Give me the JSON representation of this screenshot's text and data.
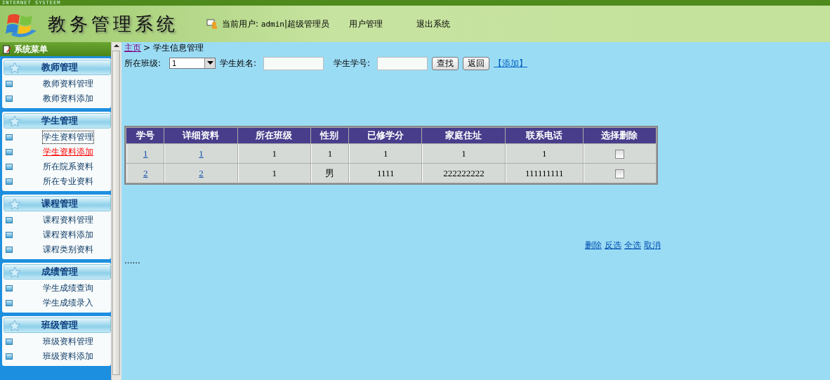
{
  "top_strip": {
    "text": "INTERNET SYSTEEM"
  },
  "header": {
    "title": "教务管理系统",
    "current_user_label": "当前用户:",
    "user": "admin",
    "separator": "|",
    "role": "超级管理员",
    "links": [
      "用户管理",
      "退出系统"
    ]
  },
  "sidebar": {
    "title": "系统菜单",
    "groups": [
      {
        "title": "教师管理",
        "items": [
          {
            "label": "教师资料管理",
            "selected": false,
            "focused": false
          },
          {
            "label": "教师资料添加",
            "selected": false,
            "focused": false
          }
        ]
      },
      {
        "title": "学生管理",
        "items": [
          {
            "label": "学生资料管理",
            "selected": false,
            "focused": true
          },
          {
            "label": "学生资料添加",
            "selected": true,
            "focused": false
          },
          {
            "label": "所在院系资料",
            "selected": false,
            "focused": false
          },
          {
            "label": "所在专业资料",
            "selected": false,
            "focused": false
          }
        ]
      },
      {
        "title": "课程管理",
        "items": [
          {
            "label": "课程资料管理",
            "selected": false,
            "focused": false
          },
          {
            "label": "课程资料添加",
            "selected": false,
            "focused": false
          },
          {
            "label": "课程类别资料",
            "selected": false,
            "focused": false
          }
        ]
      },
      {
        "title": "成绩管理",
        "items": [
          {
            "label": "学生成绩查询",
            "selected": false,
            "focused": false
          },
          {
            "label": "学生成绩录入",
            "selected": false,
            "focused": false
          }
        ]
      },
      {
        "title": "班级管理",
        "items": [
          {
            "label": "班级资料管理",
            "selected": false,
            "focused": false
          },
          {
            "label": "班级资料添加",
            "selected": false,
            "focused": false
          }
        ]
      }
    ]
  },
  "breadcrumb": {
    "home": "主页",
    "separator": ">",
    "current": "学生信息管理"
  },
  "filters": {
    "class_label": "所在班级:",
    "class_value": "1",
    "name_label": "学生姓名:",
    "number_label": "学生学号:",
    "search_button": "查找",
    "back_button": "返回",
    "add_link": "【添加】"
  },
  "table": {
    "columns": [
      "学号",
      "详细资料",
      "所在班级",
      "性别",
      "已修学分",
      "家庭住址",
      "联系电话",
      "选择删除"
    ],
    "rows": [
      {
        "cells": [
          "1",
          "1",
          "1",
          "1",
          "1",
          "1",
          "1"
        ],
        "checked": false
      },
      {
        "cells": [
          "2",
          "2",
          "1",
          "男",
          "1111",
          "222222222",
          "111111111"
        ],
        "checked": false
      }
    ]
  },
  "actions": [
    "删除",
    "反选",
    "全选",
    "取消"
  ],
  "footer_text": "......"
}
